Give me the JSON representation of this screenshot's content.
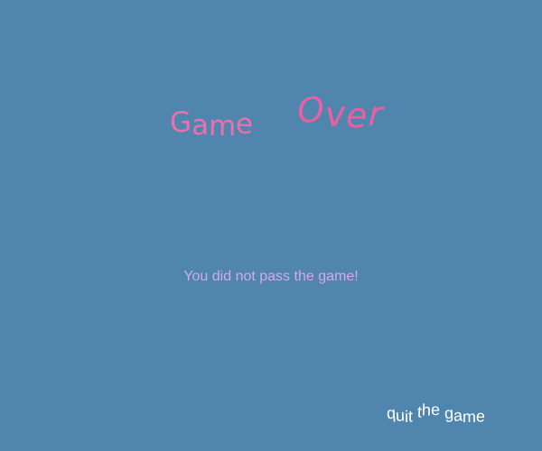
{
  "title": {
    "word1": "Game",
    "word2": "Over"
  },
  "message": "You did not pass the game!",
  "quit_label": "quit the game",
  "colors": {
    "background": "#5086ad",
    "title": "#ee6fae",
    "message": "#d5a8e8",
    "quit": "#ffffff"
  }
}
